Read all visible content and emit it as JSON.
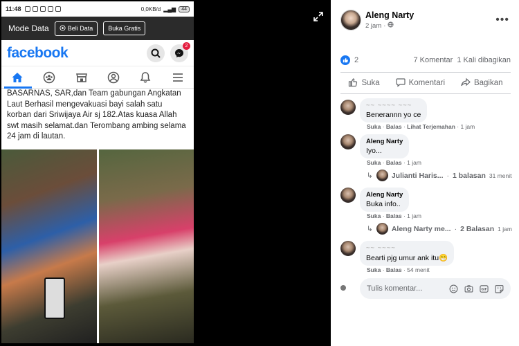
{
  "phone": {
    "status": {
      "time": "11:48",
      "data_rate": "0,0KB/d",
      "battery": "44"
    },
    "mode_bar": {
      "title": "Mode Data",
      "buy_label": "Beli Data",
      "free_label": "Buka Gratis"
    },
    "brand": "facebook",
    "messenger_badge": "2",
    "post_text": "BASARNAS, SAR,dan Team gabungan Angkatan Laut Berhasil mengevakuasi bayi salah satu korban dari Sriwijaya Air sj 182.Atas kuasa Allah swt masih selamat.dan Terombang ambing selama 24 jam di lautan."
  },
  "panel": {
    "author": "Aleng Narty",
    "time": "2 jam",
    "reactions": {
      "count": "2",
      "comments": "7 Komentar",
      "shares": "1 Kali dibagikan"
    },
    "actions": {
      "like": "Suka",
      "comment": "Komentari",
      "share": "Bagikan"
    },
    "comments": [
      {
        "name": "~~ ~~~~ ~~~",
        "text": "Benerannn yo ce",
        "like": "Suka",
        "reply": "Balas",
        "translate": "Lihat Terjemahan",
        "time": "1 jam"
      },
      {
        "name": "Aleng Narty",
        "text": "Iyo...",
        "like": "Suka",
        "reply": "Balas",
        "time": "1 jam",
        "replies": {
          "name": "Julianti Haris...",
          "count": "1 balasan",
          "time": "31 menit"
        }
      },
      {
        "name": "Aleng Narty",
        "text": "Buka info..",
        "like": "Suka",
        "reply": "Balas",
        "time": "1 jam",
        "replies": {
          "name": "Aleng Narty me...",
          "count": "2 Balasan",
          "time": "1 jam"
        }
      },
      {
        "name": "~~ ~~~~",
        "text": "Bearti pjg umur ank itu😁",
        "like": "Suka",
        "reply": "Balas",
        "time": "54 menit"
      }
    ],
    "input_placeholder": "Tulis komentar...",
    "colors": {
      "brand": "#1877f2",
      "muted": "#65676b",
      "bubble": "#f0f2f5"
    }
  }
}
